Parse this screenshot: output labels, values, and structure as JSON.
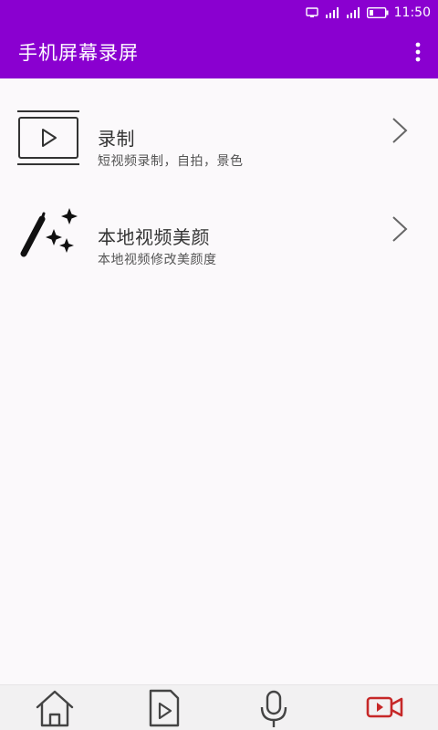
{
  "status_bar": {
    "time": "11:50",
    "icons": [
      "cast-icon",
      "signal-icon",
      "signal-icon",
      "battery-icon"
    ]
  },
  "app_bar": {
    "title": "手机屏幕录屏",
    "menu_icon": "more-vert-icon"
  },
  "menu": {
    "items": [
      {
        "title": "录制",
        "subtitle": "短视频录制，自拍，景色",
        "icon": "video-play-icon"
      },
      {
        "title": "本地视频美颜",
        "subtitle": "本地视频修改美颜度",
        "icon": "magic-wand-icon"
      }
    ]
  },
  "bottom_nav": {
    "items": [
      {
        "icon": "home-icon",
        "active": false
      },
      {
        "icon": "video-file-icon",
        "active": false
      },
      {
        "icon": "microphone-icon",
        "active": false
      },
      {
        "icon": "video-camera-icon",
        "active": true
      }
    ]
  },
  "colors": {
    "primary": "#8a00d0",
    "background": "#fbf9fb",
    "nav_active": "#c62828",
    "nav_inactive": "#444444"
  }
}
